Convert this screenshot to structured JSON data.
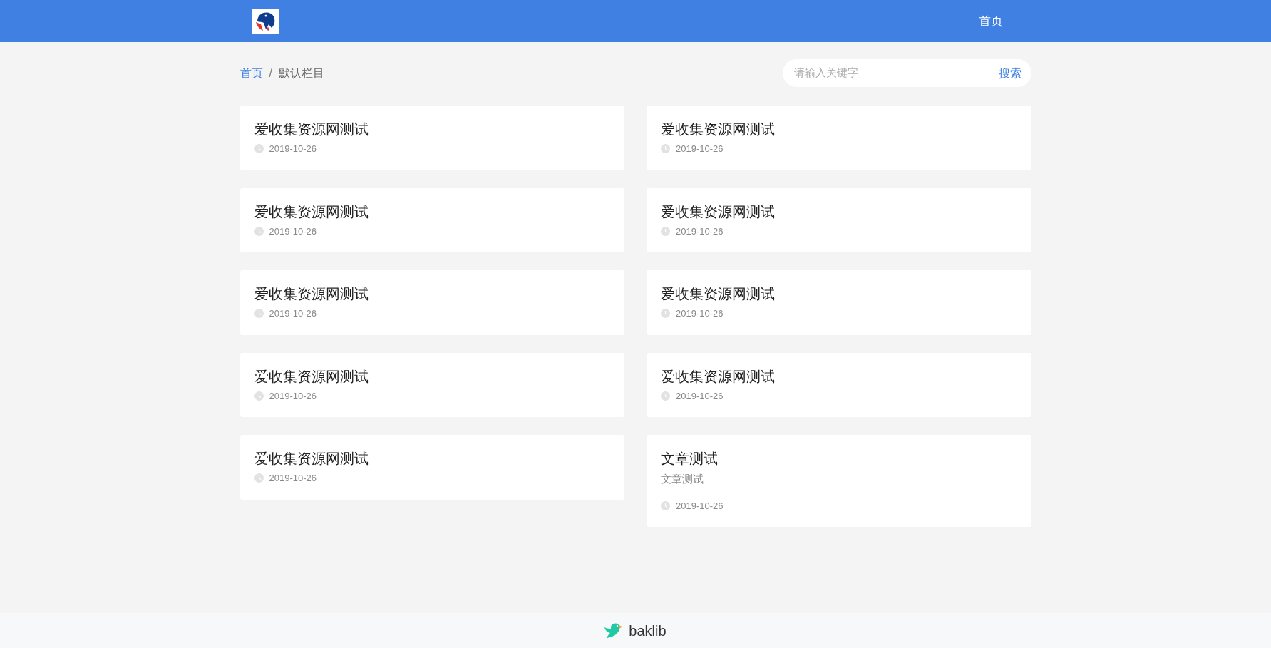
{
  "header": {
    "nav": [
      {
        "label": "首页",
        "selected": false
      }
    ]
  },
  "breadcrumb": [
    {
      "label": "首页",
      "kind": "link"
    },
    {
      "label": "/",
      "kind": "separator"
    },
    {
      "label": "默认栏目",
      "kind": "current"
    }
  ],
  "search": {
    "placeholder": "请输入关键字",
    "button": "搜索"
  },
  "articles": [
    {
      "title": "爱收集资源网测试",
      "date": "2019-10-26"
    },
    {
      "title": "爱收集资源网测试",
      "date": "2019-10-26"
    },
    {
      "title": "爱收集资源网测试",
      "date": "2019-10-26"
    },
    {
      "title": "爱收集资源网测试",
      "date": "2019-10-26"
    },
    {
      "title": "爱收集资源网测试",
      "date": "2019-10-26"
    },
    {
      "title": "爱收集资源网测试",
      "date": "2019-10-26"
    },
    {
      "title": "爱收集资源网测试",
      "date": "2019-10-26"
    },
    {
      "title": "爱收集资源网测试",
      "date": "2019-10-26"
    },
    {
      "title": "爱收集资源网测试",
      "date": "2019-10-26"
    },
    {
      "title": "文章测试",
      "summary": "文章测试",
      "date": "2019-10-26"
    }
  ],
  "footer": {
    "brand": "baklib"
  }
}
